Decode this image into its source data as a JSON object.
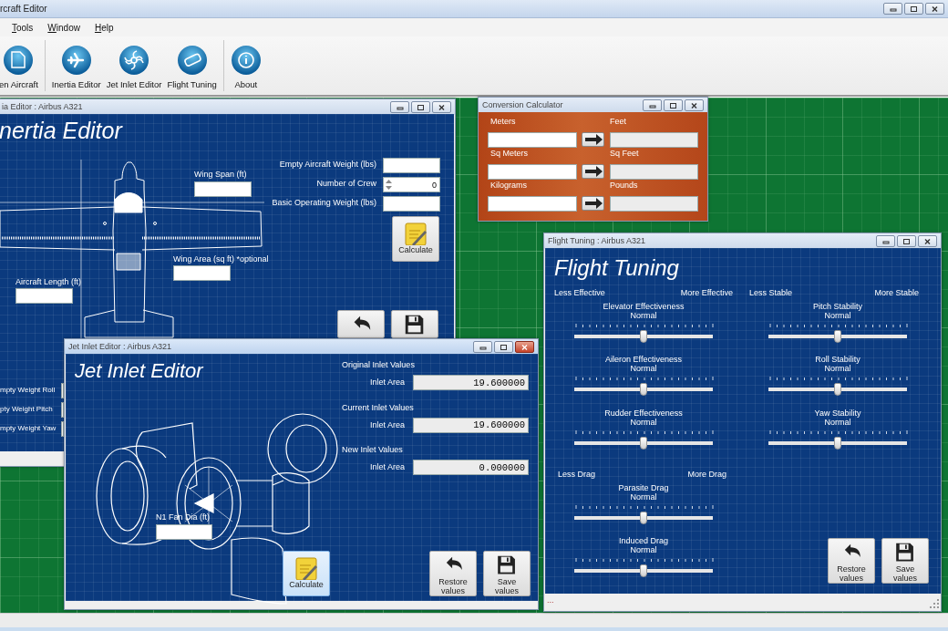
{
  "app": {
    "title": "rcraft Editor"
  },
  "menu": [
    {
      "label": "Tools"
    },
    {
      "label": "Window"
    },
    {
      "label": "Help"
    }
  ],
  "toolbar": [
    {
      "label": "en Aircraft"
    },
    {
      "label": "Inertia Editor"
    },
    {
      "label": "Jet Inlet Editor"
    },
    {
      "label": "Flight Tuning"
    },
    {
      "label": "About"
    }
  ],
  "inertia_editor": {
    "title": "ia Editor : Airbus A321",
    "active": false,
    "heading": "nertia Editor",
    "fields": [
      {
        "label": "Wing Span (ft)"
      },
      {
        "label": "Wing Area (sq ft) *optional"
      },
      {
        "label": "Aircraft Length (ft)"
      },
      {
        "label": "Empty Aircraft Weight (lbs)"
      },
      {
        "label": "Basic Operating Weight (lbs)"
      }
    ],
    "crew": {
      "label": "Number of Crew",
      "value": "0"
    },
    "side_fields": [
      {
        "label": "mpty Weight Roll"
      },
      {
        "label": "pty Weight Pitch"
      },
      {
        "label": "mpty Weight Yaw"
      }
    ],
    "calculate_button": "Calculate"
  },
  "conversion_calculator": {
    "title": "Conversion Calculator",
    "active": false,
    "rows": [
      {
        "from": "Meters",
        "to": "Feet"
      },
      {
        "from": "Sq Meters",
        "to": "Sq Feet"
      },
      {
        "from": "Kilograms",
        "to": "Pounds"
      }
    ]
  },
  "flight_tuning": {
    "title": "Flight Tuning : Airbus A321",
    "active": false,
    "heading": "Flight Tuning",
    "ranges": [
      {
        "low": "Less Effective",
        "high": "More Effective"
      },
      {
        "low": "Less Stable",
        "high": "More Stable"
      },
      {
        "low": "Less Drag",
        "high": "More Drag"
      }
    ],
    "sliders": [
      {
        "label": "Elevator Effectiveness",
        "reading": "Normal",
        "level": 0.5
      },
      {
        "label": "Pitch Stability",
        "reading": "Normal",
        "level": 0.5
      },
      {
        "label": "Aileron Effectiveness",
        "reading": "Normal",
        "level": 0.5
      },
      {
        "label": "Roll Stability",
        "reading": "Normal",
        "level": 0.5
      },
      {
        "label": "Rudder Effectiveness",
        "reading": "Normal",
        "level": 0.5
      },
      {
        "label": "Yaw Stability",
        "reading": "Normal",
        "level": 0.5
      },
      {
        "label": "Parasite Drag",
        "reading": "Normal",
        "level": 0.5
      },
      {
        "label": "Induced Drag",
        "reading": "Normal",
        "level": 0.5
      }
    ],
    "restore_button": "Restore values",
    "save_button": "Save values",
    "status": "..."
  },
  "jet_inlet_editor": {
    "title": "Jet Inlet Editor : Airbus A321",
    "active": true,
    "heading": "Jet Inlet Editor",
    "groups": [
      {
        "heading": "Original Inlet Values",
        "label": "Inlet Area",
        "value": "19.600000"
      },
      {
        "heading": "Current Inlet Values",
        "label": "Inlet Area",
        "value": "19.600000"
      },
      {
        "heading": "New Inlet Values",
        "label": "Inlet Area",
        "value": "0.000000"
      }
    ],
    "fan": {
      "label": "N1 Fan Dia (ft)"
    },
    "calculate_button": "Calculate",
    "restore_button": "Restore values",
    "save_button": "Save values"
  }
}
